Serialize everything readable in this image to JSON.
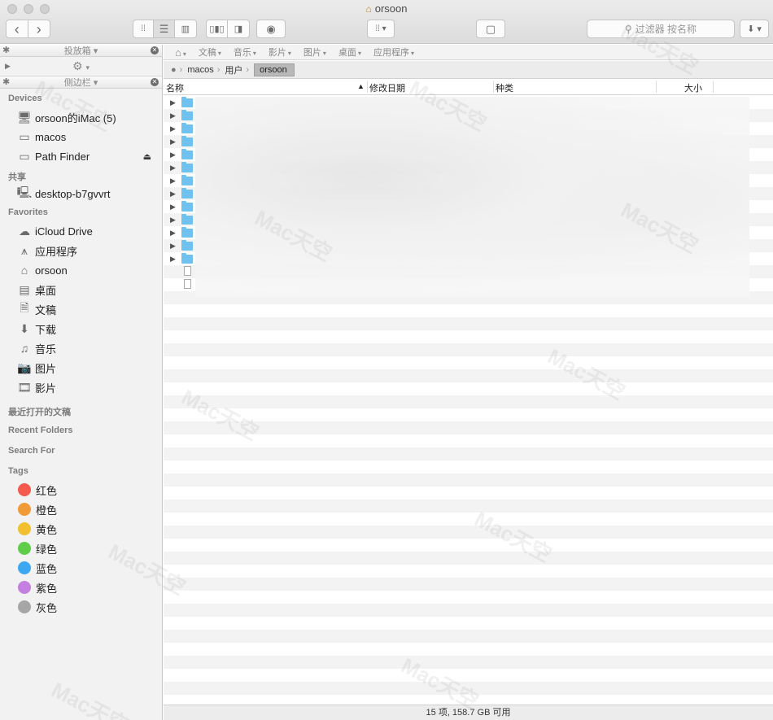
{
  "window": {
    "title": "orsoon"
  },
  "toolbar": {
    "search_placeholder": "过滤器 按名称",
    "back": "‹",
    "forward": "›"
  },
  "sidebar": {
    "top_pane": {
      "title": "投放箱"
    },
    "bottom_pane": {
      "title": "侧边栏"
    },
    "devices": {
      "label": "Devices",
      "items": [
        {
          "label": "orsoon的iMac (5)",
          "icon": "imac-icon"
        },
        {
          "label": "macos",
          "icon": "disk-icon"
        },
        {
          "label": "Path Finder",
          "icon": "disk-icon",
          "ejectable": true
        }
      ]
    },
    "shared": {
      "label": "共享",
      "items": [
        {
          "label": "desktop-b7gvvrt",
          "icon": "monitor-icon"
        }
      ]
    },
    "favorites": {
      "label": "Favorites",
      "items": [
        {
          "label": "iCloud Drive",
          "icon": "cloud-icon"
        },
        {
          "label": "应用程序",
          "icon": "apps-icon"
        },
        {
          "label": "orsoon",
          "icon": "home-icon"
        },
        {
          "label": "桌面",
          "icon": "desktop-icon"
        },
        {
          "label": "文稿",
          "icon": "documents-icon"
        },
        {
          "label": "下载",
          "icon": "download-icon"
        },
        {
          "label": "音乐",
          "icon": "music-icon"
        },
        {
          "label": "图片",
          "icon": "camera-icon"
        },
        {
          "label": "影片",
          "icon": "film-icon"
        }
      ]
    },
    "recent_docs": {
      "label": "最近打开的文稿"
    },
    "recent_folders": {
      "label": "Recent Folders"
    },
    "search_for": {
      "label": "Search For"
    },
    "tags": {
      "label": "Tags",
      "items": [
        {
          "label": "红色",
          "color": "#f55a4e"
        },
        {
          "label": "橙色",
          "color": "#f19a38"
        },
        {
          "label": "黄色",
          "color": "#f0c030"
        },
        {
          "label": "绿色",
          "color": "#5fcd4a"
        },
        {
          "label": "蓝色",
          "color": "#3ea7f1"
        },
        {
          "label": "紫色",
          "color": "#c57fe0"
        },
        {
          "label": "灰色",
          "color": "#a6a6a6"
        }
      ]
    }
  },
  "pathbar": {
    "items": [
      "文稿",
      "音乐",
      "影片",
      "图片",
      "桌面",
      "应用程序"
    ]
  },
  "breadcrumb": {
    "items": [
      "macos",
      "用户",
      "orsoon"
    ]
  },
  "columns": {
    "name": "名称",
    "modified": "修改日期",
    "kind": "种类",
    "size": "大小"
  },
  "files": [
    {
      "type": "folder"
    },
    {
      "type": "folder"
    },
    {
      "type": "folder"
    },
    {
      "type": "folder"
    },
    {
      "type": "folder"
    },
    {
      "type": "folder"
    },
    {
      "type": "folder"
    },
    {
      "type": "folder"
    },
    {
      "type": "folder"
    },
    {
      "type": "folder"
    },
    {
      "type": "folder"
    },
    {
      "type": "folder"
    },
    {
      "type": "folder"
    },
    {
      "type": "document"
    },
    {
      "type": "document"
    }
  ],
  "status": {
    "text": "15 项, 158.7 GB 可用"
  },
  "watermark": {
    "text": "Mac天空"
  }
}
